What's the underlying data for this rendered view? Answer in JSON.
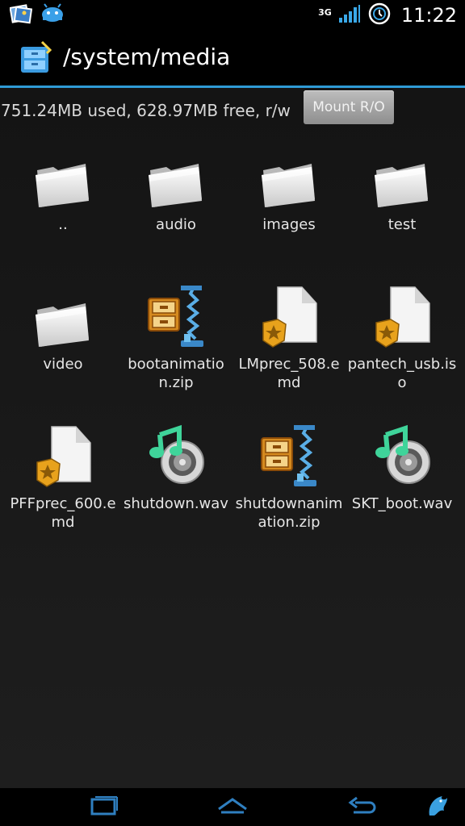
{
  "status": {
    "time": "11:22",
    "network": "3G"
  },
  "header": {
    "title": "/system/media"
  },
  "storage": {
    "info": "751.24MB used, 628.97MB free, r/w",
    "mount_label": "Mount R/O"
  },
  "files": [
    {
      "name": "..",
      "type": "folder"
    },
    {
      "name": "audio",
      "type": "folder"
    },
    {
      "name": "images",
      "type": "folder"
    },
    {
      "name": "test",
      "type": "folder"
    },
    {
      "name": "video",
      "type": "folder"
    },
    {
      "name": "bootanimation.zip",
      "type": "zip"
    },
    {
      "name": "LMprec_508.emd",
      "type": "doc"
    },
    {
      "name": "pantech_usb.iso",
      "type": "doc"
    },
    {
      "name": "PFFprec_600.emd",
      "type": "doc"
    },
    {
      "name": "shutdown.wav",
      "type": "audio"
    },
    {
      "name": "shutdownanimation.zip",
      "type": "zip"
    },
    {
      "name": "SKT_boot.wav",
      "type": "audio"
    }
  ],
  "icons": {
    "folder": "folder-icon",
    "zip": "zip-archive-icon",
    "doc": "document-badge-icon",
    "audio": "music-note-icon"
  },
  "colors": {
    "accent": "#2f9bd6",
    "background": "#1a1a1a"
  }
}
